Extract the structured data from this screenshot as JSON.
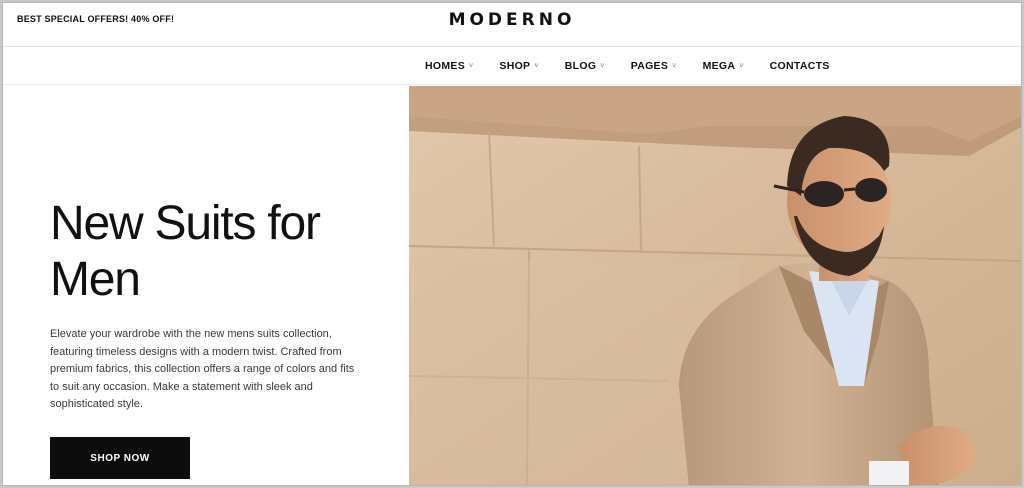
{
  "topbar": {
    "promo": "BEST SPECIAL OFFERS! 40% OFF!",
    "logo": "MODERNO"
  },
  "nav": {
    "items": [
      {
        "label": "HOMES",
        "has_dropdown": true
      },
      {
        "label": "SHOP",
        "has_dropdown": true
      },
      {
        "label": "BLOG",
        "has_dropdown": true
      },
      {
        "label": "PAGES",
        "has_dropdown": true
      },
      {
        "label": "MEGA",
        "has_dropdown": true
      },
      {
        "label": "CONTACTS",
        "has_dropdown": false
      }
    ],
    "caret": "˅"
  },
  "hero": {
    "title_line1": "New Suits for",
    "title_line2": "Men",
    "description": "Elevate your wardrobe with the new mens suits collection, featuring timeless designs with a modern twist. Crafted from premium fabrics, this collection offers a range of colors and fits to suit any occasion. Make a statement with sleek and sophisticated style.",
    "cta_label": "SHOP NOW",
    "image_subject": "man in beige suit and sunglasses against stone wall"
  },
  "colors": {
    "text": "#111111",
    "button_bg": "#0c0c0c",
    "button_text": "#ffffff",
    "wall": "#dcc1a4",
    "suit": "#c8a98a"
  }
}
